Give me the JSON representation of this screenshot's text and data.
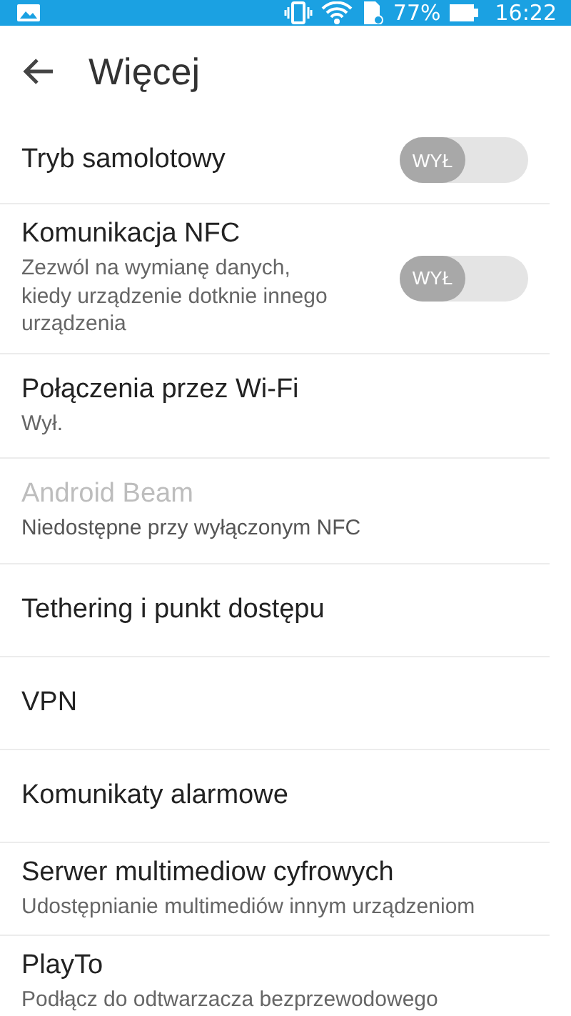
{
  "status_bar": {
    "battery": "77%",
    "time": "16:22"
  },
  "header": {
    "title": "Więcej"
  },
  "items": [
    {
      "title": "Tryb samolotowy",
      "disabled": false,
      "toggle": {
        "on": false,
        "label": "WYŁ"
      }
    },
    {
      "title": "Komunikacja NFC",
      "subtitle": "Zezwól na wymianę danych,\nkiedy urządzenie dotknie innego\nurządzenia",
      "disabled": false,
      "toggle": {
        "on": false,
        "label": "WYŁ"
      }
    },
    {
      "title": "Połączenia przez Wi-Fi",
      "subtitle": "Wył.",
      "disabled": false
    },
    {
      "title": "Android Beam",
      "subtitle": "Niedostępne przy wyłączonym NFC",
      "disabled": true
    },
    {
      "title": "Tethering i punkt dostępu",
      "disabled": false
    },
    {
      "title": "VPN",
      "disabled": false
    },
    {
      "title": "Komunikaty alarmowe",
      "disabled": false
    },
    {
      "title": "Serwer multimediow cyfrowych",
      "subtitle": "Udostępnianie multimediów innym urządzeniom",
      "disabled": false
    },
    {
      "title": "PlayTo",
      "subtitle": "Podłącz do odtwarzacza bezprzewodowego",
      "disabled": false
    }
  ]
}
